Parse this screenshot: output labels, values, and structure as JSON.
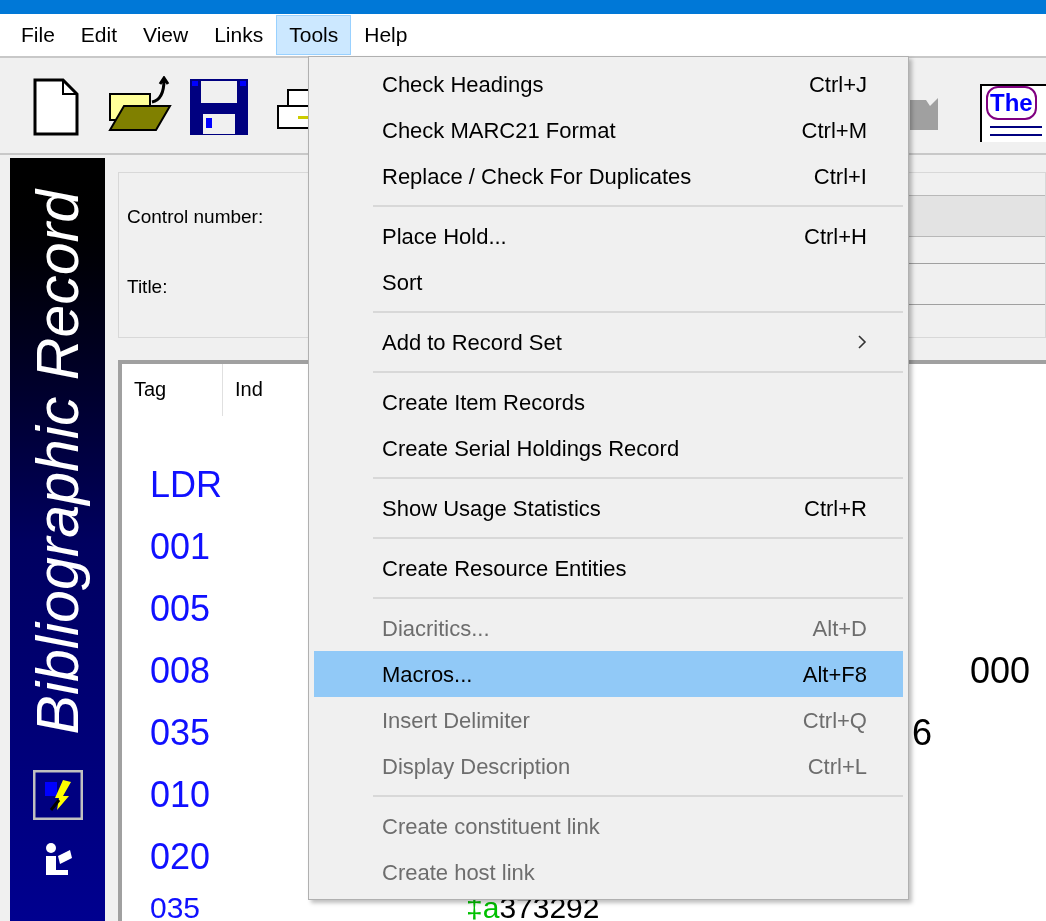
{
  "menu_bar": [
    {
      "label": "File",
      "selected": false
    },
    {
      "label": "Edit",
      "selected": false
    },
    {
      "label": "View",
      "selected": false
    },
    {
      "label": "Links",
      "selected": false
    },
    {
      "label": "Tools",
      "selected": true
    },
    {
      "label": "Help",
      "selected": false
    }
  ],
  "toolbar": {
    "thesaurus_icon_text": "The"
  },
  "side_panel": {
    "title": "Bibliographic Record"
  },
  "header": {
    "control_number_label": "Control number:",
    "title_label": "Title:"
  },
  "grid": {
    "columns": [
      "Tag",
      "Ind"
    ],
    "rows": [
      {
        "tag": "LDR"
      },
      {
        "tag": "001"
      },
      {
        "tag": "005"
      },
      {
        "tag": "008",
        "data": {
          "kind": "tail",
          "text": "000"
        }
      },
      {
        "tag": "035",
        "data": {
          "kind": "past_menu",
          "text": "6"
        }
      },
      {
        "tag": "010"
      },
      {
        "tag": "020"
      },
      {
        "tag": "035",
        "data": {
          "kind": "full",
          "code": "‡a",
          "text": "373292"
        }
      }
    ]
  },
  "tools_menu": [
    {
      "kind": "item",
      "label": "Check Headings",
      "shortcut": "Ctrl+J",
      "disabled": false,
      "selected": false
    },
    {
      "kind": "item",
      "label": "Check MARC21 Format",
      "shortcut": "Ctrl+M",
      "disabled": false,
      "selected": false
    },
    {
      "kind": "item",
      "label": "Replace / Check For Duplicates",
      "shortcut": "Ctrl+I",
      "disabled": false,
      "selected": false
    },
    {
      "kind": "separator"
    },
    {
      "kind": "item",
      "label": "Place Hold...",
      "shortcut": "Ctrl+H",
      "disabled": false,
      "selected": false
    },
    {
      "kind": "item",
      "label": "Sort",
      "disabled": false,
      "selected": false
    },
    {
      "kind": "separator"
    },
    {
      "kind": "submenu",
      "label": "Add to Record Set",
      "disabled": false,
      "selected": false
    },
    {
      "kind": "separator"
    },
    {
      "kind": "item",
      "label": "Create Item Records",
      "disabled": false,
      "selected": false
    },
    {
      "kind": "item",
      "label": "Create Serial Holdings Record",
      "disabled": false,
      "selected": false
    },
    {
      "kind": "separator"
    },
    {
      "kind": "item",
      "label": "Show Usage Statistics",
      "shortcut": "Ctrl+R",
      "disabled": false,
      "selected": false
    },
    {
      "kind": "separator"
    },
    {
      "kind": "item",
      "label": "Create Resource Entities",
      "disabled": false,
      "selected": false
    },
    {
      "kind": "separator"
    },
    {
      "kind": "item",
      "label": "Diacritics...",
      "shortcut": "Alt+D",
      "disabled": true,
      "selected": false
    },
    {
      "kind": "item",
      "label": "Macros...",
      "shortcut": "Alt+F8",
      "disabled": false,
      "selected": true
    },
    {
      "kind": "item",
      "label": "Insert Delimiter",
      "shortcut": "Ctrl+Q",
      "disabled": true,
      "selected": false
    },
    {
      "kind": "item",
      "label": "Display Description",
      "shortcut": "Ctrl+L",
      "disabled": true,
      "selected": false
    },
    {
      "kind": "separator"
    },
    {
      "kind": "item",
      "label": "Create constituent link",
      "disabled": true,
      "selected": false
    },
    {
      "kind": "item",
      "label": "Create host link",
      "disabled": true,
      "selected": false
    }
  ]
}
